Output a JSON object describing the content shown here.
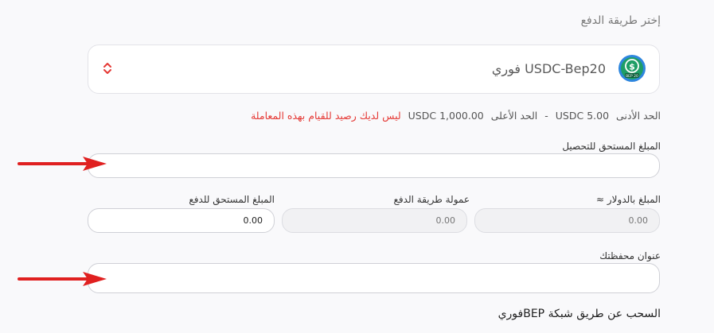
{
  "section_title": "إختر طريقة الدفع",
  "payment_method": {
    "label": "USDC-Bep20 فوري",
    "icon_text": "BEP 20",
    "icon_symbol": "$"
  },
  "limits": {
    "min_label": "الحد الأدنى",
    "min_value": "5.00 USDC",
    "separator": "-",
    "max_label": "الحد الأعلى",
    "max_value": "1,000.00 USDC",
    "error": "ليس لديك رصيد للقيام بهذه المعاملة"
  },
  "fields": {
    "amount_due_collect": {
      "label": "المبلغ المستحق للتحصيل",
      "value": ""
    },
    "usd_amount": {
      "label": "المبلغ بالدولار ≈",
      "placeholder": "0.00"
    },
    "method_fee": {
      "label": "عمولة طريقة الدفع",
      "placeholder": "0.00"
    },
    "amount_due_pay": {
      "label": "المبلغ المستحق للدفع",
      "value": "0.00"
    },
    "wallet_address": {
      "label": "عنوان محفظتك",
      "value": ""
    }
  },
  "footer_text": "السحب عن طريق شبكة BEPفوري",
  "colors": {
    "error": "#e53935",
    "arrow": "#e02020",
    "icon_ring": "#2e86de",
    "icon_inner": "#1e9e66"
  }
}
